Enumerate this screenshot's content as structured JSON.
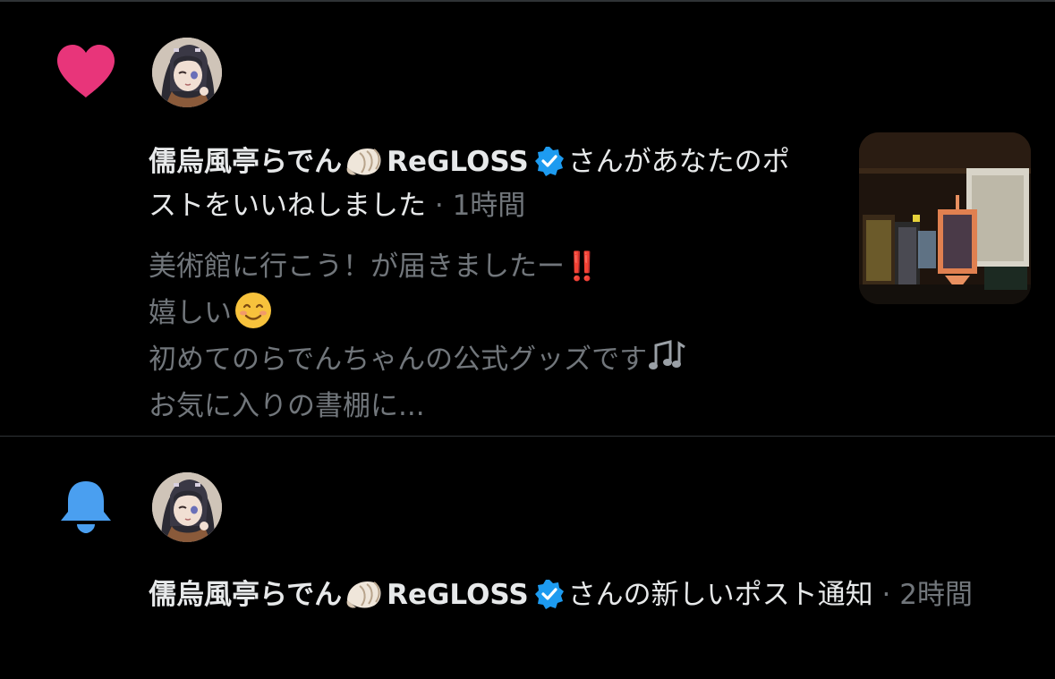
{
  "colors": {
    "background": "#000000",
    "divider": "#2f3336",
    "heart": "#e8357a",
    "bell": "#4a9ff0",
    "verified": "#1d9bf0",
    "text_primary": "#e7e9ea",
    "text_secondary": "#71767b"
  },
  "notifications": [
    {
      "type_icon": "heart-icon",
      "user_name": "儒烏風亭らでん",
      "name_emoji": "spiral-shell-icon",
      "name_suffix": "ReGLOSS",
      "verified": true,
      "action_text": "さんがあなたのポストをいいねしました",
      "separator": " · ",
      "time": "1時間",
      "post_excerpt": {
        "line1": "美術館に行こう！が届きましたー",
        "line1_emoji": "‼️",
        "line2": "嬉しい",
        "line2_emoji": "smiling-face-icon",
        "line3": "初めてのらでんちゃんの公式グッズです",
        "line3_emoji": "musical-notes-icon",
        "line4": "お気に入りの書棚に..."
      },
      "thumbnail": "post-thumbnail"
    },
    {
      "type_icon": "bell-icon",
      "user_name": "儒烏風亭らでん",
      "name_emoji": "spiral-shell-icon",
      "name_suffix": "ReGLOSS",
      "verified": true,
      "action_text": "さんの新しいポスト通知",
      "separator": " · ",
      "time": "2時間"
    }
  ]
}
